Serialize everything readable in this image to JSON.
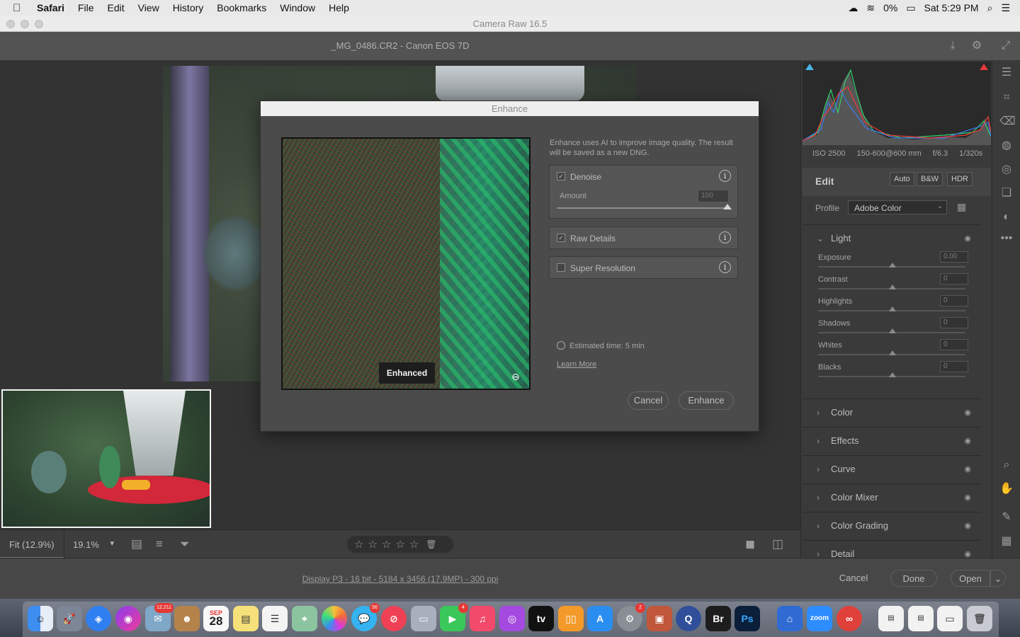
{
  "menubar": {
    "apple": "",
    "app": "Safari",
    "items": [
      "File",
      "Edit",
      "View",
      "History",
      "Bookmarks",
      "Window",
      "Help"
    ],
    "battery": "0%",
    "clock": "Sat 5:29 PM"
  },
  "window": {
    "title": "Camera Raw 16.5"
  },
  "header": {
    "filename": "_MG_0486.CR2  -  Canon EOS 7D"
  },
  "bottombar": {
    "zoom_fit": "Fit (12.9%)",
    "zoom_pct": "19.1%",
    "stars": [
      "☆",
      "☆",
      "☆",
      "☆",
      "☆"
    ],
    "trash": "🗑"
  },
  "statusbar": {
    "info": "Display P3 - 16 bit - 5184 x 3456 (17.9MP) - 300 ppi",
    "cancel": "Cancel",
    "done": "Done",
    "open": "Open",
    "open_caret": "⌄"
  },
  "panel": {
    "exif": {
      "iso": "ISO 2500",
      "lens": "150-600@600 mm",
      "aperture": "f/6.3",
      "shutter": "1/320s"
    },
    "edit_label": "Edit",
    "edit_buttons": [
      "Auto",
      "B&W",
      "HDR"
    ],
    "profile_label": "Profile",
    "profile_value": "Adobe Color",
    "light": {
      "title": "Light",
      "sliders": [
        {
          "name": "Exposure",
          "value": "0.00"
        },
        {
          "name": "Contrast",
          "value": "0"
        },
        {
          "name": "Highlights",
          "value": "0"
        },
        {
          "name": "Shadows",
          "value": "0"
        },
        {
          "name": "Whites",
          "value": "0"
        },
        {
          "name": "Blacks",
          "value": "0"
        }
      ]
    },
    "sections": [
      "Color",
      "Effects",
      "Curve",
      "Color Mixer",
      "Color Grading",
      "Detail"
    ]
  },
  "dialog": {
    "title": "Enhance",
    "preview_tag": "Enhanced",
    "description": "Enhance uses AI to improve image quality. The result will be saved as a new DNG.",
    "denoise": {
      "label": "Denoise",
      "checked": true,
      "amount_label": "Amount",
      "amount_value": "100"
    },
    "raw_details": {
      "label": "Raw Details",
      "checked": true
    },
    "super_resolution": {
      "label": "Super Resolution",
      "checked": false
    },
    "estimated": "Estimated time: 5 min",
    "learn_more": "Learn More",
    "cancel": "Cancel",
    "enhance": "Enhance"
  },
  "dock": {
    "mail_badge": "12,211",
    "calendar_month": "SEP",
    "calendar_day": "28",
    "messages_badge": "56",
    "facetime_badge": "4",
    "settings_badge": "2",
    "bridge": "Br",
    "photoshop": "Ps",
    "zoom": "zoom"
  }
}
